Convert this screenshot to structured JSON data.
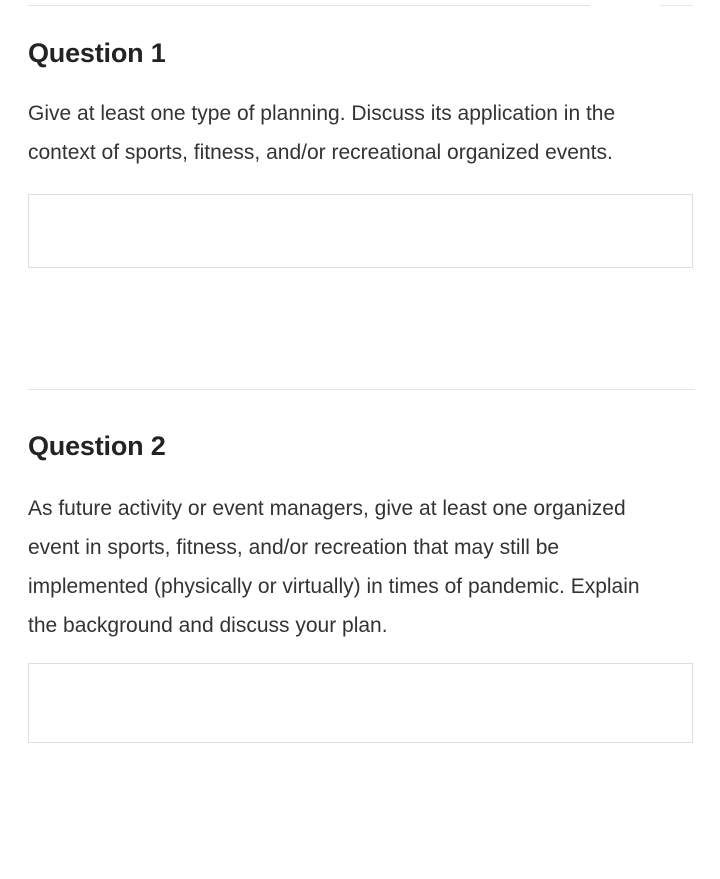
{
  "page": {
    "background_color": "#ffffff",
    "heading_color": "#232323",
    "body_text_color": "#333333",
    "divider_color": "#e3e3e3",
    "field_border_color": "#dedede"
  },
  "questions": [
    {
      "title": "Question 1",
      "prompt": "Give at least one type of planning. Discuss its application in the context of sports, fitness, and/or recreational organized events.",
      "answer": {
        "value": "",
        "placeholder": ""
      }
    },
    {
      "title": "Question 2",
      "prompt": "As future activity or event managers, give at least one organized event in sports, fitness, and/or recreation that may still be implemented (physically or virtually) in times of pandemic. Explain the background and discuss your plan.",
      "answer": {
        "value": "",
        "placeholder": ""
      }
    }
  ]
}
